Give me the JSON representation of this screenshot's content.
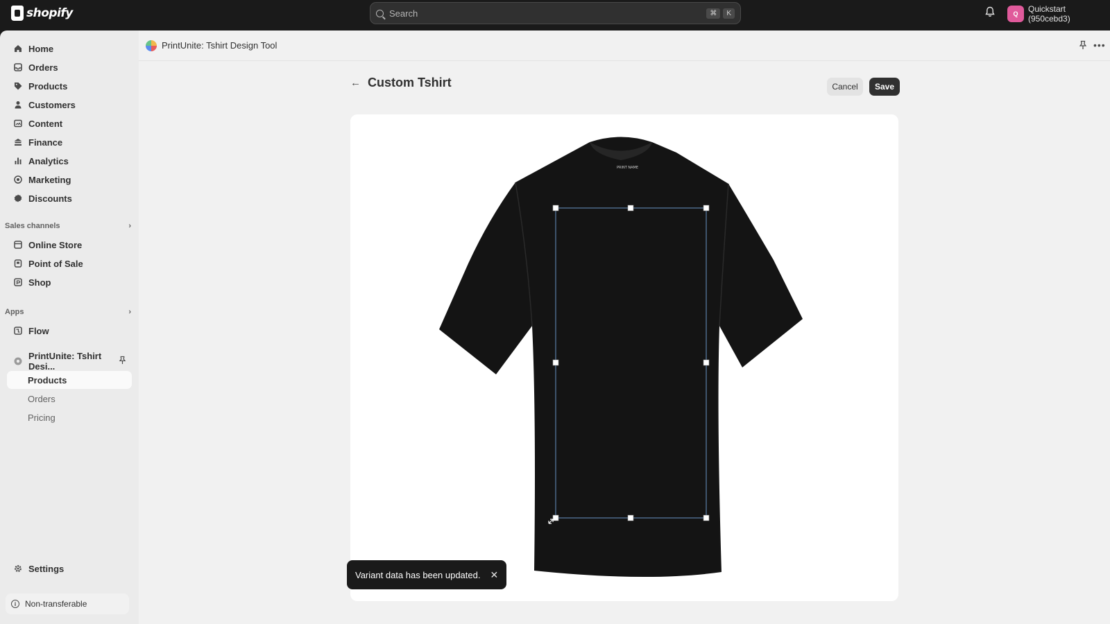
{
  "topbar": {
    "brand": "shopify",
    "search_placeholder": "Search",
    "shortcut_keys": [
      "⌘",
      "K"
    ],
    "store_initials": "Q",
    "store_name": "Quickstart (950cebd3)"
  },
  "sidebar": {
    "items": [
      {
        "label": "Home",
        "icon": "home-icon"
      },
      {
        "label": "Orders",
        "icon": "orders-icon"
      },
      {
        "label": "Products",
        "icon": "tag-icon"
      },
      {
        "label": "Customers",
        "icon": "person-icon"
      },
      {
        "label": "Content",
        "icon": "content-icon"
      },
      {
        "label": "Finance",
        "icon": "bank-icon"
      },
      {
        "label": "Analytics",
        "icon": "bar-chart-icon"
      },
      {
        "label": "Marketing",
        "icon": "target-icon"
      },
      {
        "label": "Discounts",
        "icon": "discount-icon"
      }
    ],
    "sales_channels_header": "Sales channels",
    "sales_channels": [
      {
        "label": "Online Store",
        "icon": "store-icon"
      },
      {
        "label": "Point of Sale",
        "icon": "pos-icon"
      },
      {
        "label": "Shop",
        "icon": "shop-icon"
      }
    ],
    "apps_header": "Apps",
    "apps": [
      {
        "label": "Flow",
        "icon": "flow-icon"
      }
    ],
    "pinned_app": "PrintUnite: Tshirt Desi...",
    "app_subitems": [
      "Products",
      "Orders",
      "Pricing"
    ],
    "settings": "Settings",
    "non_transferable": "Non-transferable"
  },
  "main": {
    "app_title": "PrintUnite: Tshirt Design Tool",
    "page_title": "Custom Tshirt",
    "cancel_label": "Cancel",
    "save_label": "Save",
    "collar_label": "PRINT NAME"
  },
  "toast": {
    "message": "Variant data has been updated."
  }
}
